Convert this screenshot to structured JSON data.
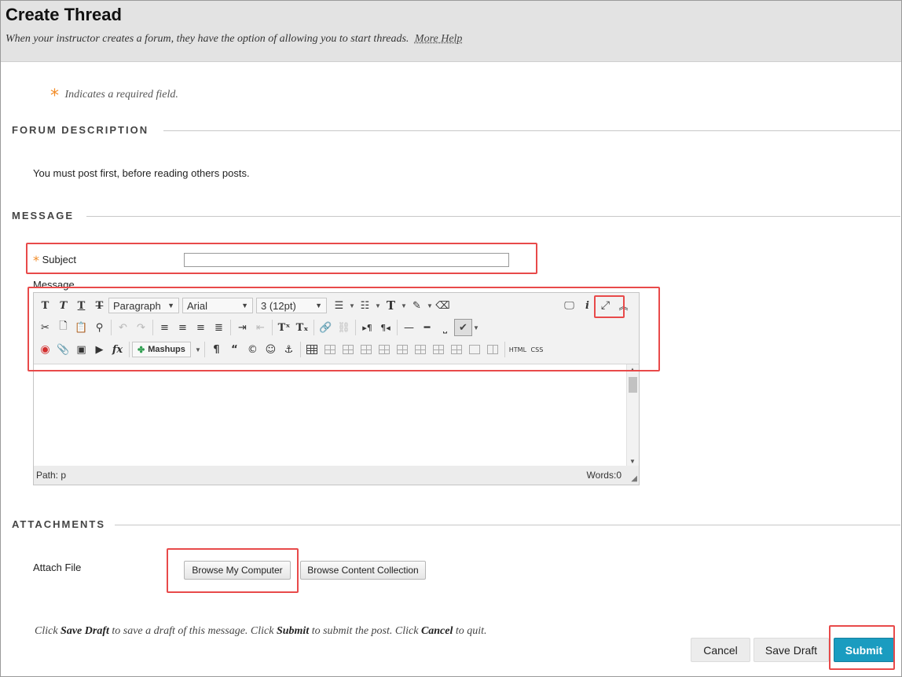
{
  "page": {
    "title": "Create Thread",
    "subtitle": "When your instructor creates a forum, they have the option of allowing you to start threads.",
    "help_link": "More Help",
    "required_note": "Indicates a required field.",
    "required_symbol": "*"
  },
  "forum_description": {
    "heading": "FORUM DESCRIPTION",
    "text": "You must post first, before reading others posts."
  },
  "message": {
    "heading": "MESSAGE",
    "subject_label": "Subject",
    "subject_value": "",
    "message_label": "Message"
  },
  "editor": {
    "paragraph_format": "Paragraph",
    "font_family": "Arial",
    "font_size": "3 (12pt)",
    "mashups_label": "Mashups",
    "html_label": "HTML",
    "css_label": "CSS",
    "path_label": "Path: p",
    "words_label": "Words:0"
  },
  "attachments": {
    "heading": "ATTACHMENTS",
    "attach_label": "Attach File",
    "browse_computer": "Browse My Computer",
    "browse_collection": "Browse Content Collection"
  },
  "instructions": {
    "p1": "Click",
    "save_draft": "Save Draft",
    "p2": "to save a draft of this message. Click",
    "submit": "Submit",
    "p3": "to submit the post. Click",
    "cancel": "Cancel",
    "p4": "to quit."
  },
  "actions": {
    "cancel": "Cancel",
    "save_draft": "Save Draft",
    "submit": "Submit"
  },
  "colors": {
    "header_bg": "#e3e3e3",
    "required_star": "#f28c28",
    "highlight": "#e84a4a",
    "submit_bg": "#1a9cc0"
  }
}
